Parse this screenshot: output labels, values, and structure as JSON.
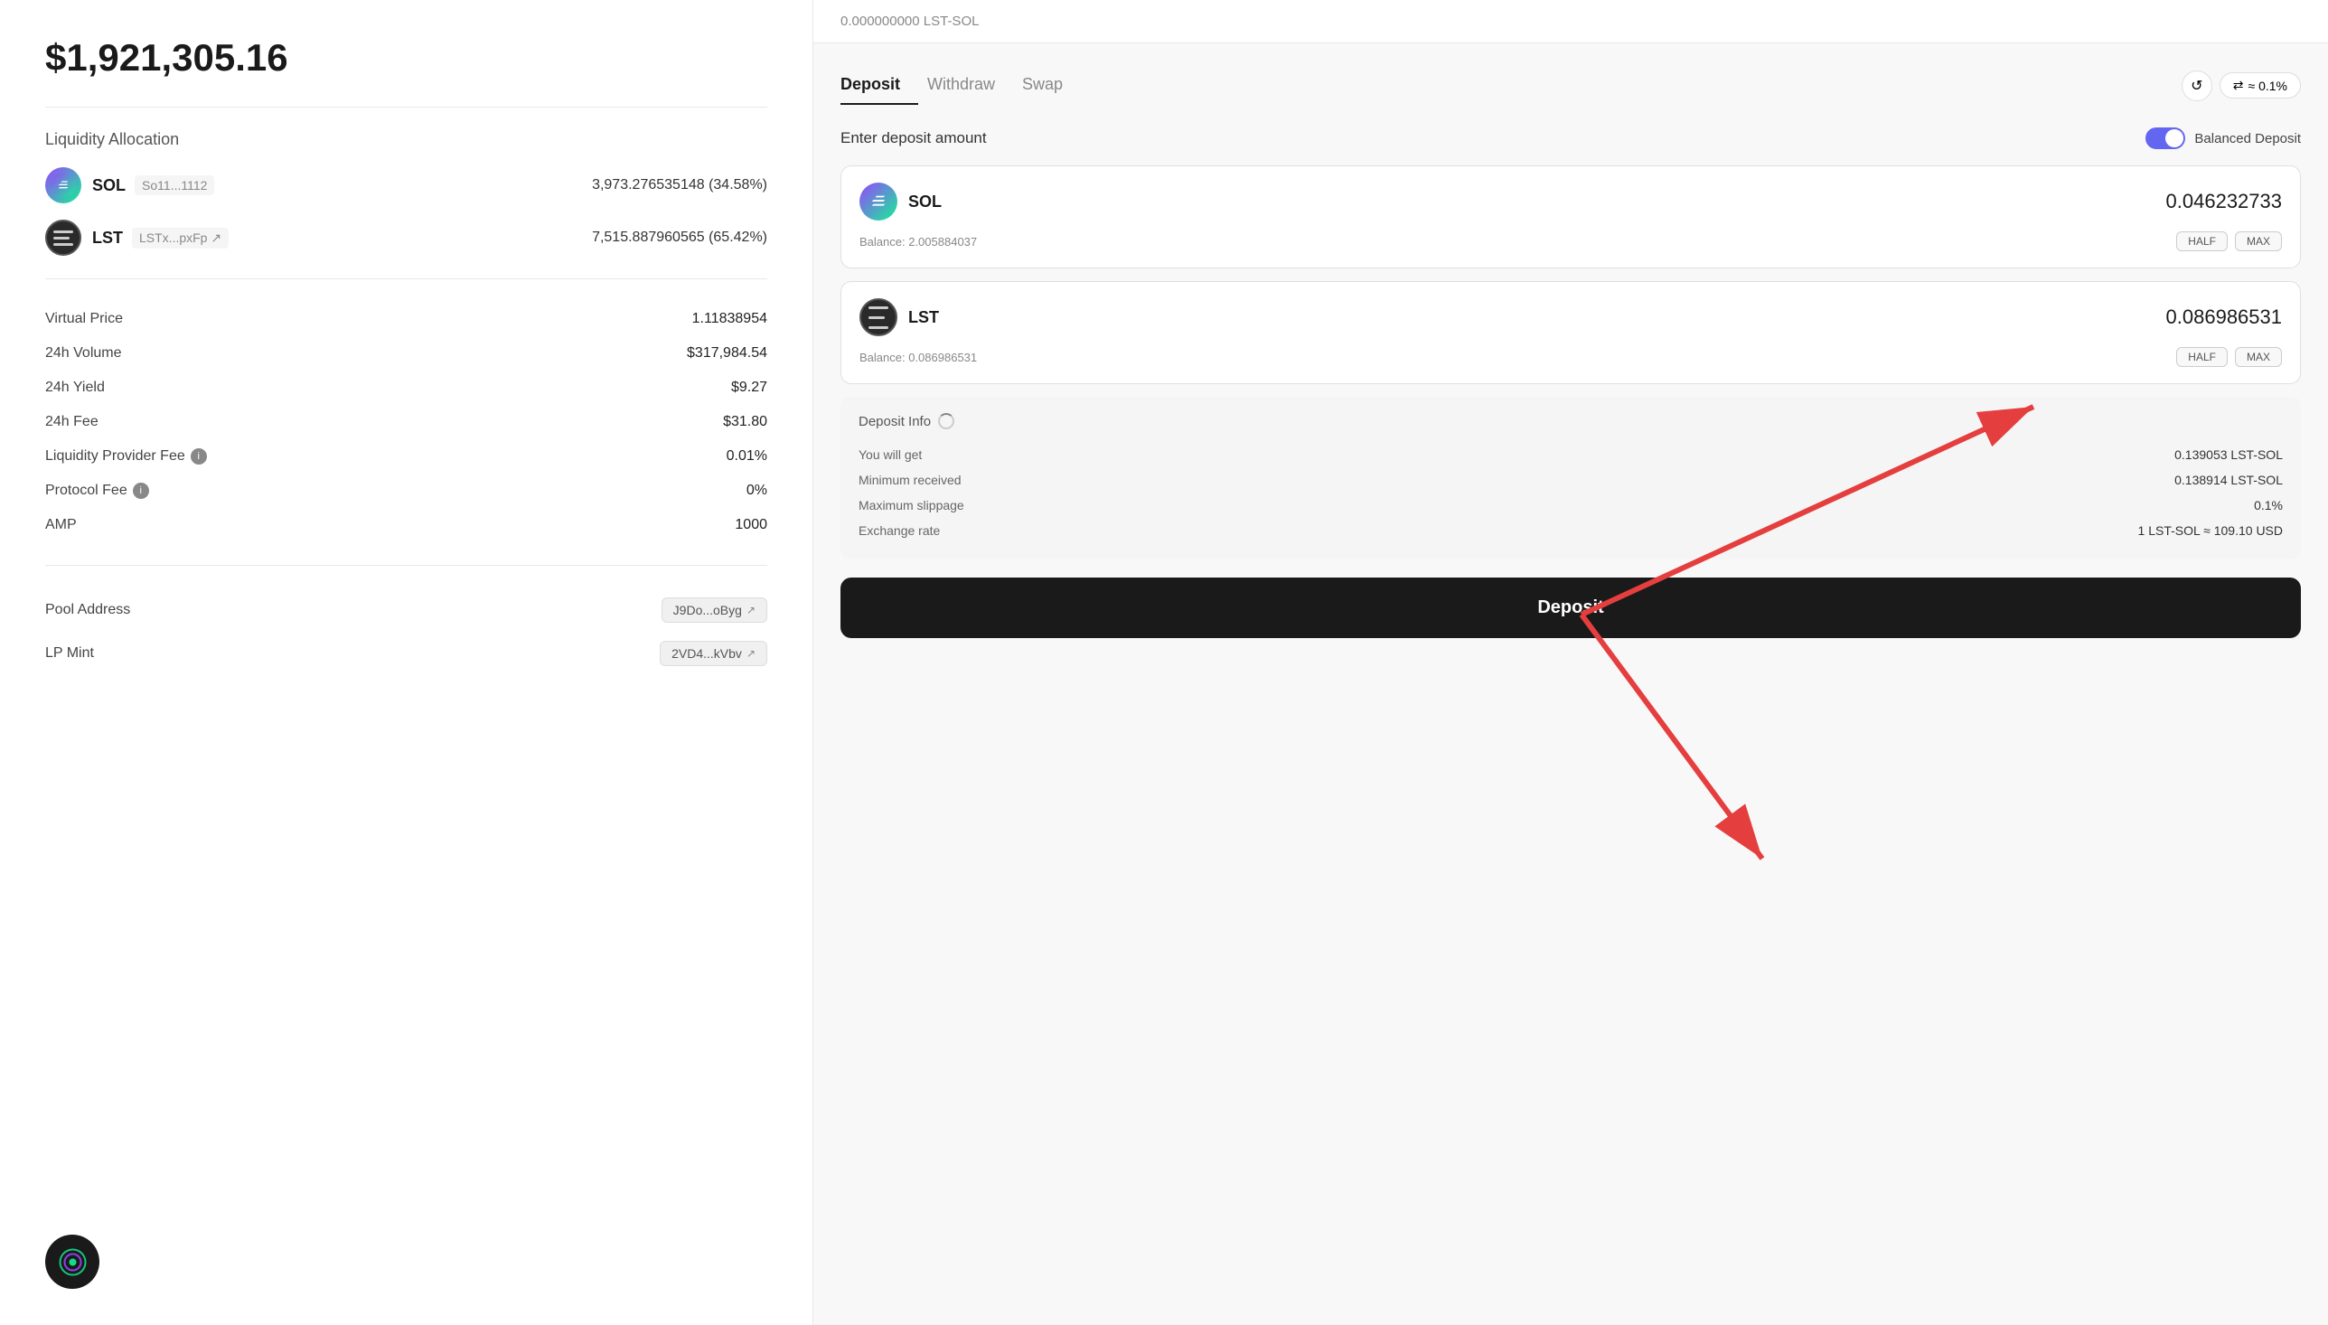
{
  "page": {
    "title": "$1,921,305.16"
  },
  "left": {
    "liquidity_allocation_label": "Liquidity Allocation",
    "tokens": [
      {
        "symbol": "SOL",
        "address": "So11...1112",
        "amount": "3,973.276535148 (34.58%)"
      },
      {
        "symbol": "LST",
        "address": "LSTx...pxFp",
        "amount": "7,515.887960565 (65.42%)"
      }
    ],
    "stats": [
      {
        "label": "Virtual Price",
        "value": "1.11838954",
        "has_info": false
      },
      {
        "label": "24h Volume",
        "value": "$317,984.54",
        "has_info": false
      },
      {
        "label": "24h Yield",
        "value": "$9.27",
        "has_info": false
      },
      {
        "label": "24h Fee",
        "value": "$31.80",
        "has_info": false
      },
      {
        "label": "Liquidity Provider Fee",
        "value": "0.01%",
        "has_info": true
      },
      {
        "label": "Protocol Fee",
        "value": "0%",
        "has_info": true
      },
      {
        "label": "AMP",
        "value": "1000",
        "has_info": false
      }
    ],
    "pool_address_label": "Pool Address",
    "pool_address": "J9Do...oByg",
    "lp_mint_label": "LP Mint",
    "lp_mint": "2VD4...kVbv"
  },
  "right": {
    "top_bar_text": "0.000000000 LST-SOL",
    "tabs": [
      {
        "label": "Deposit",
        "active": true
      },
      {
        "label": "Withdraw",
        "active": false
      },
      {
        "label": "Swap",
        "active": false
      }
    ],
    "slippage": "≈ 0.1%",
    "enter_deposit_label": "Enter deposit amount",
    "balanced_deposit_label": "Balanced Deposit",
    "sol_input": {
      "symbol": "SOL",
      "amount": "0.046232733",
      "balance_label": "Balance:",
      "balance": "2.005884037"
    },
    "lst_input": {
      "symbol": "LST",
      "amount": "0.086986531",
      "balance_label": "Balance:",
      "balance": "0.086986531"
    },
    "half_label": "HALF",
    "max_label": "MAX",
    "deposit_info_label": "Deposit Info",
    "deposit_info": [
      {
        "label": "You will get",
        "value": "0.139053 LST-SOL"
      },
      {
        "label": "Minimum received",
        "value": "0.138914 LST-SOL"
      },
      {
        "label": "Maximum slippage",
        "value": "0.1%"
      },
      {
        "label": "Exchange rate",
        "value": "1 LST-SOL ≈ 109.10 USD"
      }
    ],
    "deposit_button_label": "Deposit"
  }
}
